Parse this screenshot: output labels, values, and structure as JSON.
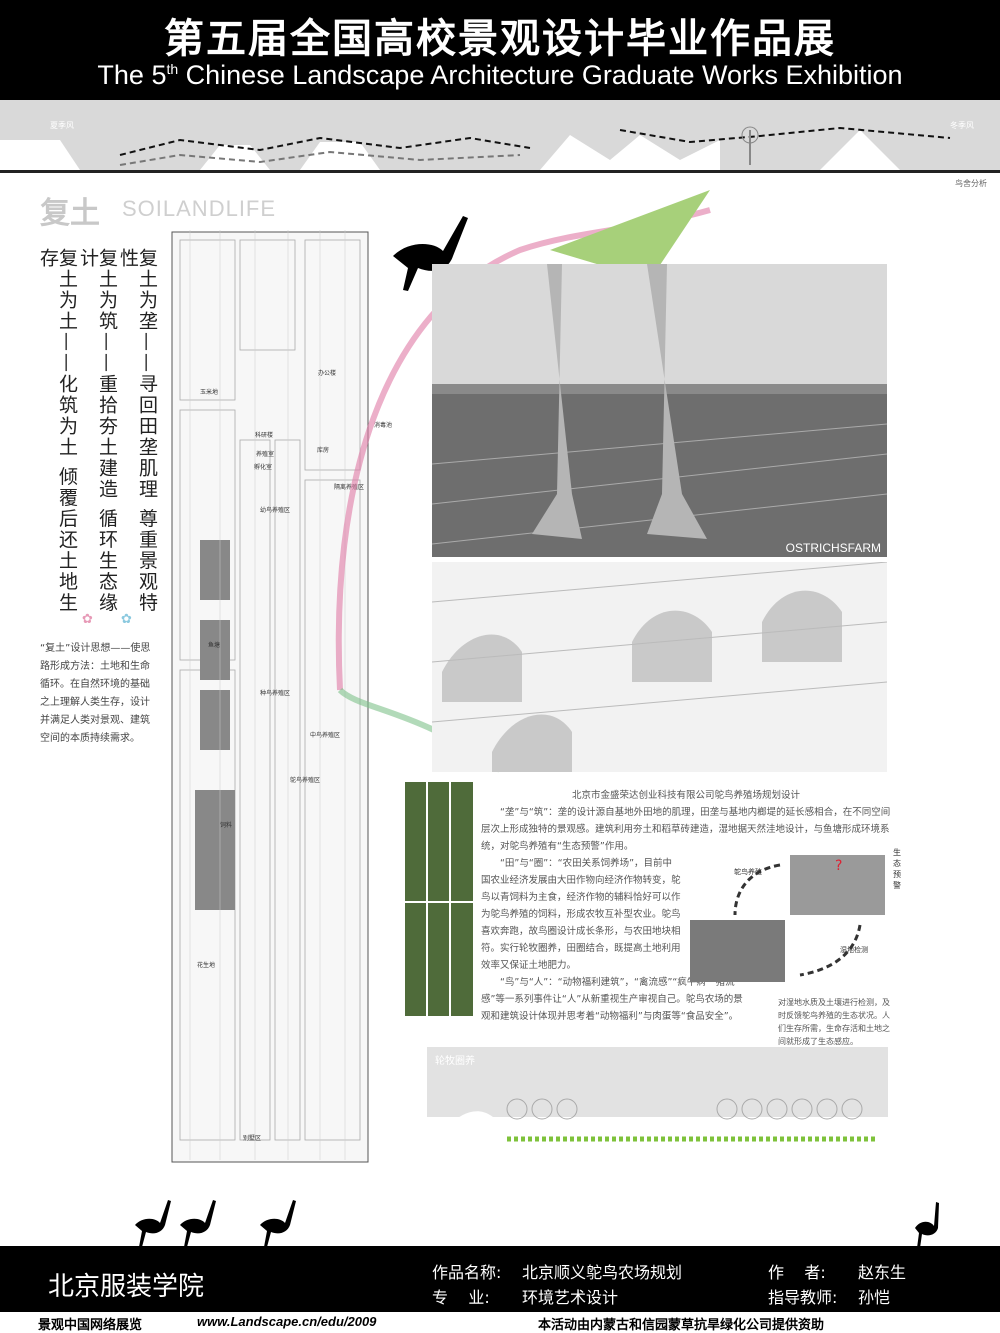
{
  "header": {
    "title_cn": "第五届全国高校景观设计毕业作品展",
    "title_en_pre": "The 5",
    "title_en_sup": "th",
    "title_en_post": " Chinese Landscape Architecture Graduate Works Exhibition"
  },
  "strip": {
    "left_label": "夏季风",
    "right_label": "冬季风",
    "caption": "鸟舍分析"
  },
  "section": {
    "title_cn": "复土",
    "title_en": "SOILANDLIFE"
  },
  "slogans": [
    "复土为垄——寻回田垄肌理 尊重景观特性",
    "复土为筑——重拾夯土建造 循环生态缘计",
    "复土为土——化筑为土 倾覆后还土地生存"
  ],
  "intro_text": "“复土”设计思想——使思路形成方法：土地和生命循环。在自然环境的基础之上理解人类生存，设计并满足人类对景观、建筑空间的本质持续需求。",
  "site_plan_labels": [
    "玉米地",
    "办公楼",
    "库房",
    "科研楼",
    "养殖室",
    "孵化室",
    "消毒池",
    "隔离养殖区",
    "幼鸟养殖区",
    "种鸟养殖区",
    "中鸟养殖区",
    "鸵鸟养殖区",
    "花生地",
    "鱼塘",
    "饲料",
    "别墅区"
  ],
  "render": {
    "label": "OSTRICHSFARM"
  },
  "description": {
    "heading": "北京市金盛荣达创业科技有限公司鸵鸟养殖场规划设计",
    "para1": "“垄”与“筑”：垄的设计源自基地外田地的肌理，田垄与基地内榔堤的延长感相合，在不同空间层次上形成独特的景观感。建筑利用夯土和稻草砖建造，湿地据天然洼地设计，与鱼塘形成环境系统，对鸵鸟养殖有“生态预警”作用。",
    "para2": "“田”与“圈”：“农田关系饲养场”，目前中国农业经济发展由大田作物向经济作物转变，鸵鸟以青饲料为主食，经济作物的辅料恰好可以作为鸵鸟养殖的饲料，形成农牧互补型农业。鸵鸟喜欢奔跑，故鸟圈设计成长条形，与农田地块相符。实行轮牧圈养，田圈结合，既提高土地利用效率又保证土地肥力。",
    "para3": "“鸟”与“人”：“动物福利建筑”，“禽流感”“疯牛病”“猪流感”等一系列事件让“人”从新重视生产审视自己。鸵鸟农场的景观和建筑设计体现并思考着“动物福利”与肉蛋等“食品安全”。"
  },
  "diagram": {
    "label_top": "生态预警",
    "label_left": "鸵鸟养殖",
    "label_right": "湿地检测",
    "note": "对湿地水质及土壤进行检测，及时反馈鸵鸟养殖的生态状况。人们生存所需，生命存活和土地之间就形成了生态感应。"
  },
  "section_label": "轮牧圈养",
  "footer": {
    "school": "北京服装学院",
    "work_label": "作品名称:",
    "work_value": "北京顺义鸵鸟农场规划",
    "major_label": "专    业:",
    "major_value": "环境艺术设计",
    "author_label": "作    者:",
    "author_value": "赵东生",
    "advisor_label": "指导教师:",
    "advisor_value": "孙恺"
  },
  "bottom": {
    "left": "景观中国网络展览",
    "url": "www.Landscape.cn/edu/2009",
    "right": "本活动由内蒙古和信园蒙草抗旱绿化公司提供资助"
  }
}
